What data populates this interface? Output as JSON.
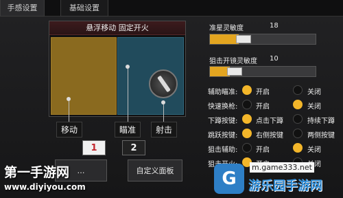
{
  "tabs": [
    {
      "label": "手感设置",
      "active": true
    },
    {
      "label": "基础设置",
      "active": false
    }
  ],
  "layout_panel": {
    "title": "悬浮移动 固定开火",
    "labels": {
      "move": "移动",
      "aim": "瞄准",
      "fire": "射击"
    },
    "colors": {
      "move_zone": "#8a6a1f",
      "aim_zone": "#214b5c"
    }
  },
  "presets": {
    "preset1": "1",
    "preset2": "2",
    "selected": "1"
  },
  "buttons": {
    "left": "…",
    "custom_panel": "自定义面板"
  },
  "sensitivity": {
    "star": {
      "label": "准星灵敏度",
      "value": "18",
      "fill": 0.18
    },
    "scope": {
      "label": "狙击开镜灵敏度",
      "value": "10",
      "fill": 0.1
    }
  },
  "options": [
    {
      "name": "辅助瞄准:",
      "a": "开启",
      "b": "关闭",
      "selected": "a"
    },
    {
      "name": "快速换枪:",
      "a": "开启",
      "b": "关闭",
      "selected": "b"
    },
    {
      "name": "下蹲按键:",
      "a": "点击下蹲",
      "b": "持续下蹲",
      "selected": "a"
    },
    {
      "name": "跳跃按键:",
      "a": "右侧按键",
      "b": "两侧按键",
      "selected": "a"
    },
    {
      "name": "狙击辅助:",
      "a": "开启",
      "b": "关闭",
      "selected": "b"
    },
    {
      "name": "狙击开火:",
      "a": "开启",
      "b": "关闭",
      "selected": "a"
    }
  ],
  "watermarks": {
    "left_title": "第一手游网",
    "left_url": "www.diyiyou.com",
    "right_url": "m.game333.net",
    "right_brand": "游乐园手游网",
    "right_logo": "G"
  },
  "accent_color": "#f3b62a"
}
